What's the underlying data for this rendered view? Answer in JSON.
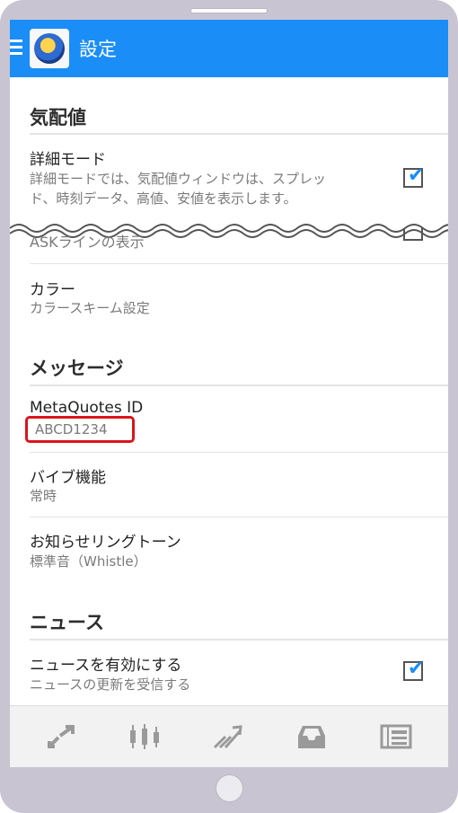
{
  "app": {
    "title": "設定"
  },
  "sections": {
    "quotes": {
      "header": "気配値",
      "detail_mode": {
        "label": "詳細モード",
        "description_line1": "詳細モードでは、気配値ウィンドウは、スプレッ",
        "description_line2": "ド、時刻データ、高値、安値を表示します。",
        "checked": true
      },
      "ask_line": {
        "label": "ASKラインの表示"
      },
      "color": {
        "label": "カラー",
        "value": "カラースキーム設定"
      }
    },
    "messages": {
      "header": "メッセージ",
      "metaquotes_id": {
        "label": "MetaQuotes ID",
        "value": "ABCD1234"
      },
      "vibration": {
        "label": "バイブ機能",
        "value": "常時"
      },
      "ringtone": {
        "label": "お知らせリングトーン",
        "value": "標準音（Whistle）"
      }
    },
    "news": {
      "header": "ニュース",
      "enable_news": {
        "label": "ニュースを有効にする",
        "description": "ニュースの更新を受信する",
        "checked": true
      }
    }
  },
  "bottom_nav": [
    "quotes-icon",
    "chart-icon",
    "trade-icon",
    "mailbox-icon",
    "news-icon"
  ],
  "colors": {
    "appbar": "#1a8df7",
    "check": "#1a8df7",
    "highlight": "#d9151b"
  }
}
